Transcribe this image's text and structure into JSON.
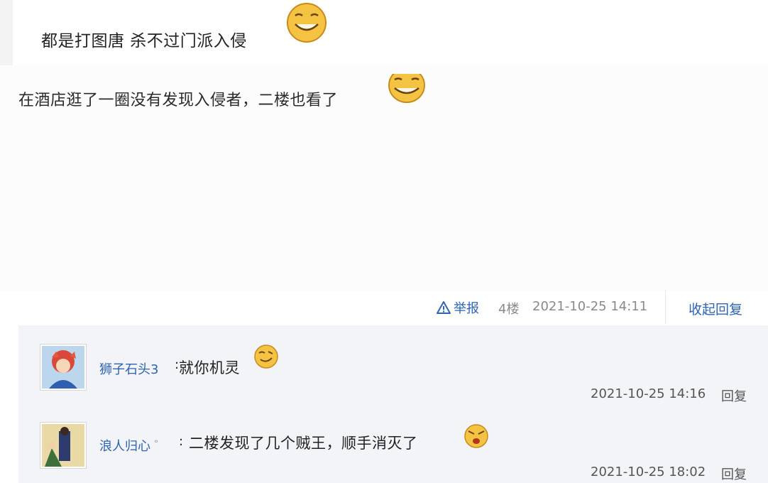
{
  "top_line": {
    "text": "都是打图唐 杀不过门派入侵"
  },
  "post": {
    "text": "在酒店逛了一圈没有发现入侵者，二楼也看了"
  },
  "meta": {
    "report_label": "举报",
    "floor": "4楼",
    "time": "2021-10-25 14:11",
    "collapse_label": "收起回复"
  },
  "replies": [
    {
      "user": "狮子石头3",
      "sep": ":",
      "text": "就你机灵",
      "time": "2021-10-25 14:16",
      "reply_label": "回复",
      "emoji": "smirk-face-icon"
    },
    {
      "user": "浪人归心",
      "badge": "ᵒ",
      "sep": ":",
      "text": "二楼发现了几个贼王，顺手消灭了",
      "time": "2021-10-25 18:02",
      "reply_label": "回复",
      "emoji": "angry-face-icon"
    }
  ],
  "colors": {
    "link_blue": "#2d64b3",
    "meta_gray": "#8a8a8a",
    "reply_bg": "#f3f4f8",
    "emoji_yellow": "#f5c342"
  }
}
